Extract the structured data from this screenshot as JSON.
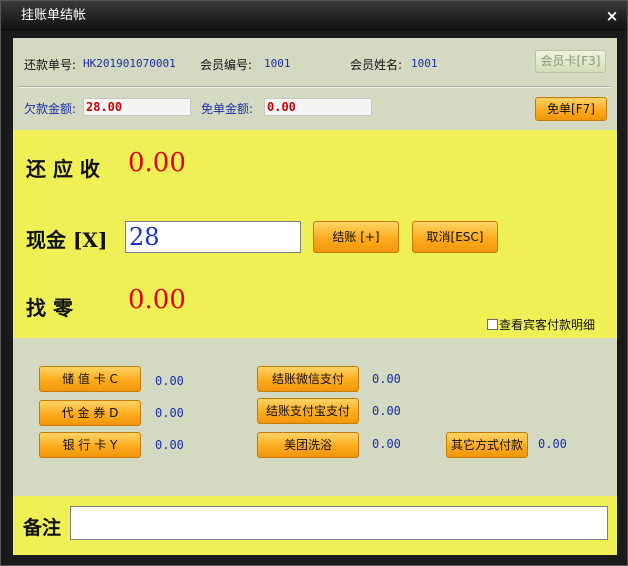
{
  "window": {
    "title": "挂账单结帐",
    "close_glyph": "×"
  },
  "info": {
    "order_no_label": "还款单号:",
    "order_no": "HK201901070001",
    "member_no_label": "会员编号:",
    "member_no": "1001",
    "member_name_label": "会员姓名:",
    "member_name": "1001",
    "member_card_button": "会员卡[F3]"
  },
  "debt": {
    "debt_label": "欠款金额:",
    "debt_value": "28.00",
    "waive_label": "免单金额:",
    "waive_value": "0.00",
    "waive_button": "免单[F7]"
  },
  "summary": {
    "due_label": "还 应 收",
    "due_value": "0.00",
    "cash_label": "现金 [X]",
    "cash_value": "28",
    "checkout_button": "结账 [+]",
    "cancel_button": "取消[ESC]",
    "change_label": "找    零",
    "change_value": "0.00",
    "detail_checkbox_label": "查看宾客付款明细"
  },
  "payments": {
    "stored_card": "储 值 卡 C",
    "stored_card_value": "0.00",
    "voucher": "代 金 券 D",
    "voucher_value": "0.00",
    "bank_card": "银 行 卡 Y",
    "bank_card_value": "0.00",
    "wechat": "结账微信支付",
    "wechat_value": "0.00",
    "alipay": "结账支付宝支付",
    "alipay_value": "0.00",
    "meituan": "美团洗浴",
    "meituan_value": "0.00",
    "other": "其它方式付款",
    "other_value": "0.00"
  },
  "note": {
    "label": "备注",
    "value": ""
  }
}
